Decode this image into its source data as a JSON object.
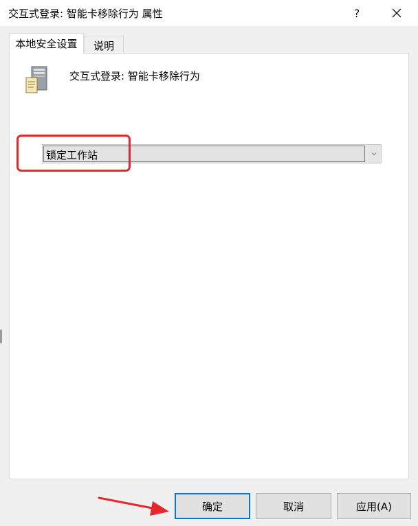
{
  "window": {
    "title": "交互式登录: 智能卡移除行为 属性",
    "help_label": "?"
  },
  "tabs": [
    {
      "label": "本地安全设置",
      "active": true
    },
    {
      "label": "说明",
      "active": false
    }
  ],
  "policy": {
    "icon": "server-icon",
    "name": "交互式登录: 智能卡移除行为"
  },
  "dropdown": {
    "selected_value": "锁定工作站"
  },
  "buttons": {
    "ok_label": "确定",
    "cancel_label": "取消",
    "apply_label": "应用(A)"
  },
  "colors": {
    "accent": "#0078d7",
    "annotation": "#e8262b"
  }
}
